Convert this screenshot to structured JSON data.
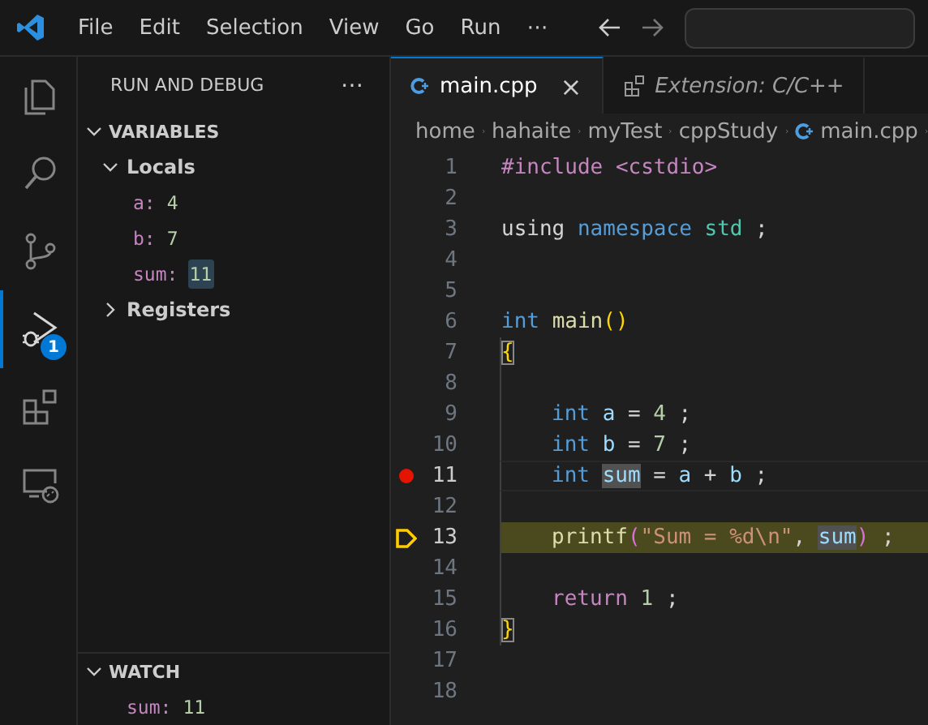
{
  "menu": [
    "File",
    "Edit",
    "Selection",
    "View",
    "Go",
    "Run",
    "⋯"
  ],
  "activity_bar": [
    {
      "kind": "files",
      "selected": false
    },
    {
      "kind": "search",
      "selected": false
    },
    {
      "kind": "branch",
      "selected": false
    },
    {
      "kind": "debug",
      "selected": true,
      "badge": "1"
    },
    {
      "kind": "extensions",
      "selected": false
    },
    {
      "kind": "remote",
      "selected": false
    }
  ],
  "sidebar": {
    "title": "RUN AND DEBUG",
    "more": "⋯",
    "sections": [
      {
        "title": "VARIABLES",
        "expanded": true,
        "children": [
          {
            "label": "Locals",
            "expanded": true,
            "children": [
              {
                "name": "a:",
                "value": "4",
                "changed": false
              },
              {
                "name": "b:",
                "value": "7",
                "changed": false
              },
              {
                "name": "sum:",
                "value": "11",
                "changed": true
              }
            ]
          },
          {
            "label": "Registers",
            "expanded": false
          }
        ]
      },
      {
        "title": "WATCH",
        "expanded": true,
        "items": [
          {
            "name": "sum:",
            "value": "11",
            "changed": false
          }
        ]
      }
    ]
  },
  "tabs": [
    {
      "label": "main.cpp",
      "kind": "file",
      "selected": true,
      "preview": false,
      "close": "×"
    },
    {
      "label": "Extension: C/C++",
      "kind": "extension",
      "selected": false,
      "preview": true
    }
  ],
  "breadcrumbs": [
    {
      "label": "home"
    },
    {
      "label": "hahaite"
    },
    {
      "label": "myTest"
    },
    {
      "label": "cppStudy"
    },
    {
      "label": "main.cpp",
      "kind": "file"
    }
  ],
  "code": [
    {
      "number": "1",
      "tokens": [
        {
          "kind": "pre",
          "text": "#include <cstdio>"
        }
      ]
    },
    {
      "number": "2"
    },
    {
      "number": "3",
      "tokens": [
        {
          "kind": "plain",
          "text": "using "
        },
        {
          "kind": "kw",
          "text": "namespace "
        },
        {
          "kind": "type",
          "text": "std"
        },
        {
          "kind": "plain",
          "text": " ;"
        }
      ]
    },
    {
      "number": "4"
    },
    {
      "number": "5"
    },
    {
      "number": "6",
      "tokens": [
        {
          "kind": "kw",
          "text": "int "
        },
        {
          "kind": "fn",
          "text": "main"
        },
        {
          "kind": "brace",
          "text": "()"
        }
      ]
    },
    {
      "number": "7",
      "tokens": [
        {
          "kind": "brace",
          "text": "{",
          "matched": true
        }
      ]
    },
    {
      "number": "8"
    },
    {
      "number": "9",
      "indented": true,
      "tokens": [
        {
          "kind": "kw",
          "text": "int "
        },
        {
          "kind": "var",
          "text": "a"
        },
        {
          "kind": "plain",
          "text": " = "
        },
        {
          "kind": "num",
          "text": "4"
        },
        {
          "kind": "plain",
          "text": " ;"
        }
      ]
    },
    {
      "number": "10",
      "indented": true,
      "tokens": [
        {
          "kind": "kw",
          "text": "int "
        },
        {
          "kind": "var",
          "text": "b"
        },
        {
          "kind": "plain",
          "text": " = "
        },
        {
          "kind": "num",
          "text": "7"
        },
        {
          "kind": "plain",
          "text": " ;"
        }
      ]
    },
    {
      "number": "11",
      "breakpoint": true,
      "indented": true,
      "tokens": [
        {
          "kind": "kw",
          "text": "int "
        },
        {
          "kind": "var",
          "text": "sum",
          "highlighted": true
        },
        {
          "kind": "plain",
          "text": " = "
        },
        {
          "kind": "var",
          "text": "a"
        },
        {
          "kind": "plain",
          "text": " + "
        },
        {
          "kind": "var",
          "text": "b"
        },
        {
          "kind": "plain",
          "text": " ;"
        }
      ]
    },
    {
      "number": "12"
    },
    {
      "number": "13",
      "current": true,
      "indented": true,
      "tokens": [
        {
          "kind": "fn",
          "text": "printf"
        },
        {
          "kind": "paren",
          "text": "("
        },
        {
          "kind": "str",
          "text": "\"Sum = %d\\n\""
        },
        {
          "kind": "plain",
          "text": ", "
        },
        {
          "kind": "var",
          "text": "sum",
          "highlighted": true
        },
        {
          "kind": "paren",
          "text": ")"
        },
        {
          "kind": "plain",
          "text": " ;"
        }
      ]
    },
    {
      "number": "14"
    },
    {
      "number": "15",
      "indented": true,
      "tokens": [
        {
          "kind": "ctl",
          "text": "return "
        },
        {
          "kind": "num",
          "text": "1"
        },
        {
          "kind": "plain",
          "text": " ;"
        }
      ]
    },
    {
      "number": "16",
      "tokens": [
        {
          "kind": "brace",
          "text": "}",
          "matched": true
        }
      ]
    },
    {
      "number": "17"
    },
    {
      "number": "18"
    }
  ]
}
